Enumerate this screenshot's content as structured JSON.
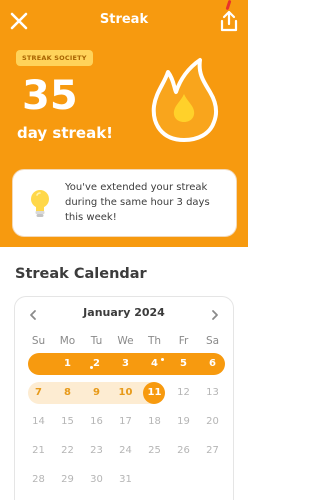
{
  "header": {
    "title": "Streak"
  },
  "badge": "STREAK SOCIETY",
  "streak": {
    "count": "35",
    "label": "day streak!"
  },
  "info_card": {
    "message": "You've extended your streak during the same hour 3 days this week!"
  },
  "calendar": {
    "section_title": "Streak Calendar",
    "month": "January 2024",
    "weekdays": [
      "Su",
      "Mo",
      "Tu",
      "We",
      "Th",
      "Fr",
      "Sa"
    ],
    "weeks": [
      [
        "",
        "1",
        "2",
        "3",
        "4",
        "5",
        "6"
      ],
      [
        "7",
        "8",
        "9",
        "10",
        "11",
        "12",
        "13"
      ],
      [
        "14",
        "15",
        "16",
        "17",
        "18",
        "19",
        "20"
      ],
      [
        "21",
        "22",
        "23",
        "24",
        "25",
        "26",
        "27"
      ],
      [
        "28",
        "29",
        "30",
        "31",
        "",
        "",
        ""
      ]
    ],
    "today": "11"
  },
  "colors": {
    "accent": "#f79a0f",
    "badge_bg": "#ffd35a",
    "soft_fill": "#fdecd2"
  },
  "icons": {
    "close": "close-icon",
    "share": "share-icon",
    "flame": "flame-icon",
    "bulb": "lightbulb-icon"
  }
}
